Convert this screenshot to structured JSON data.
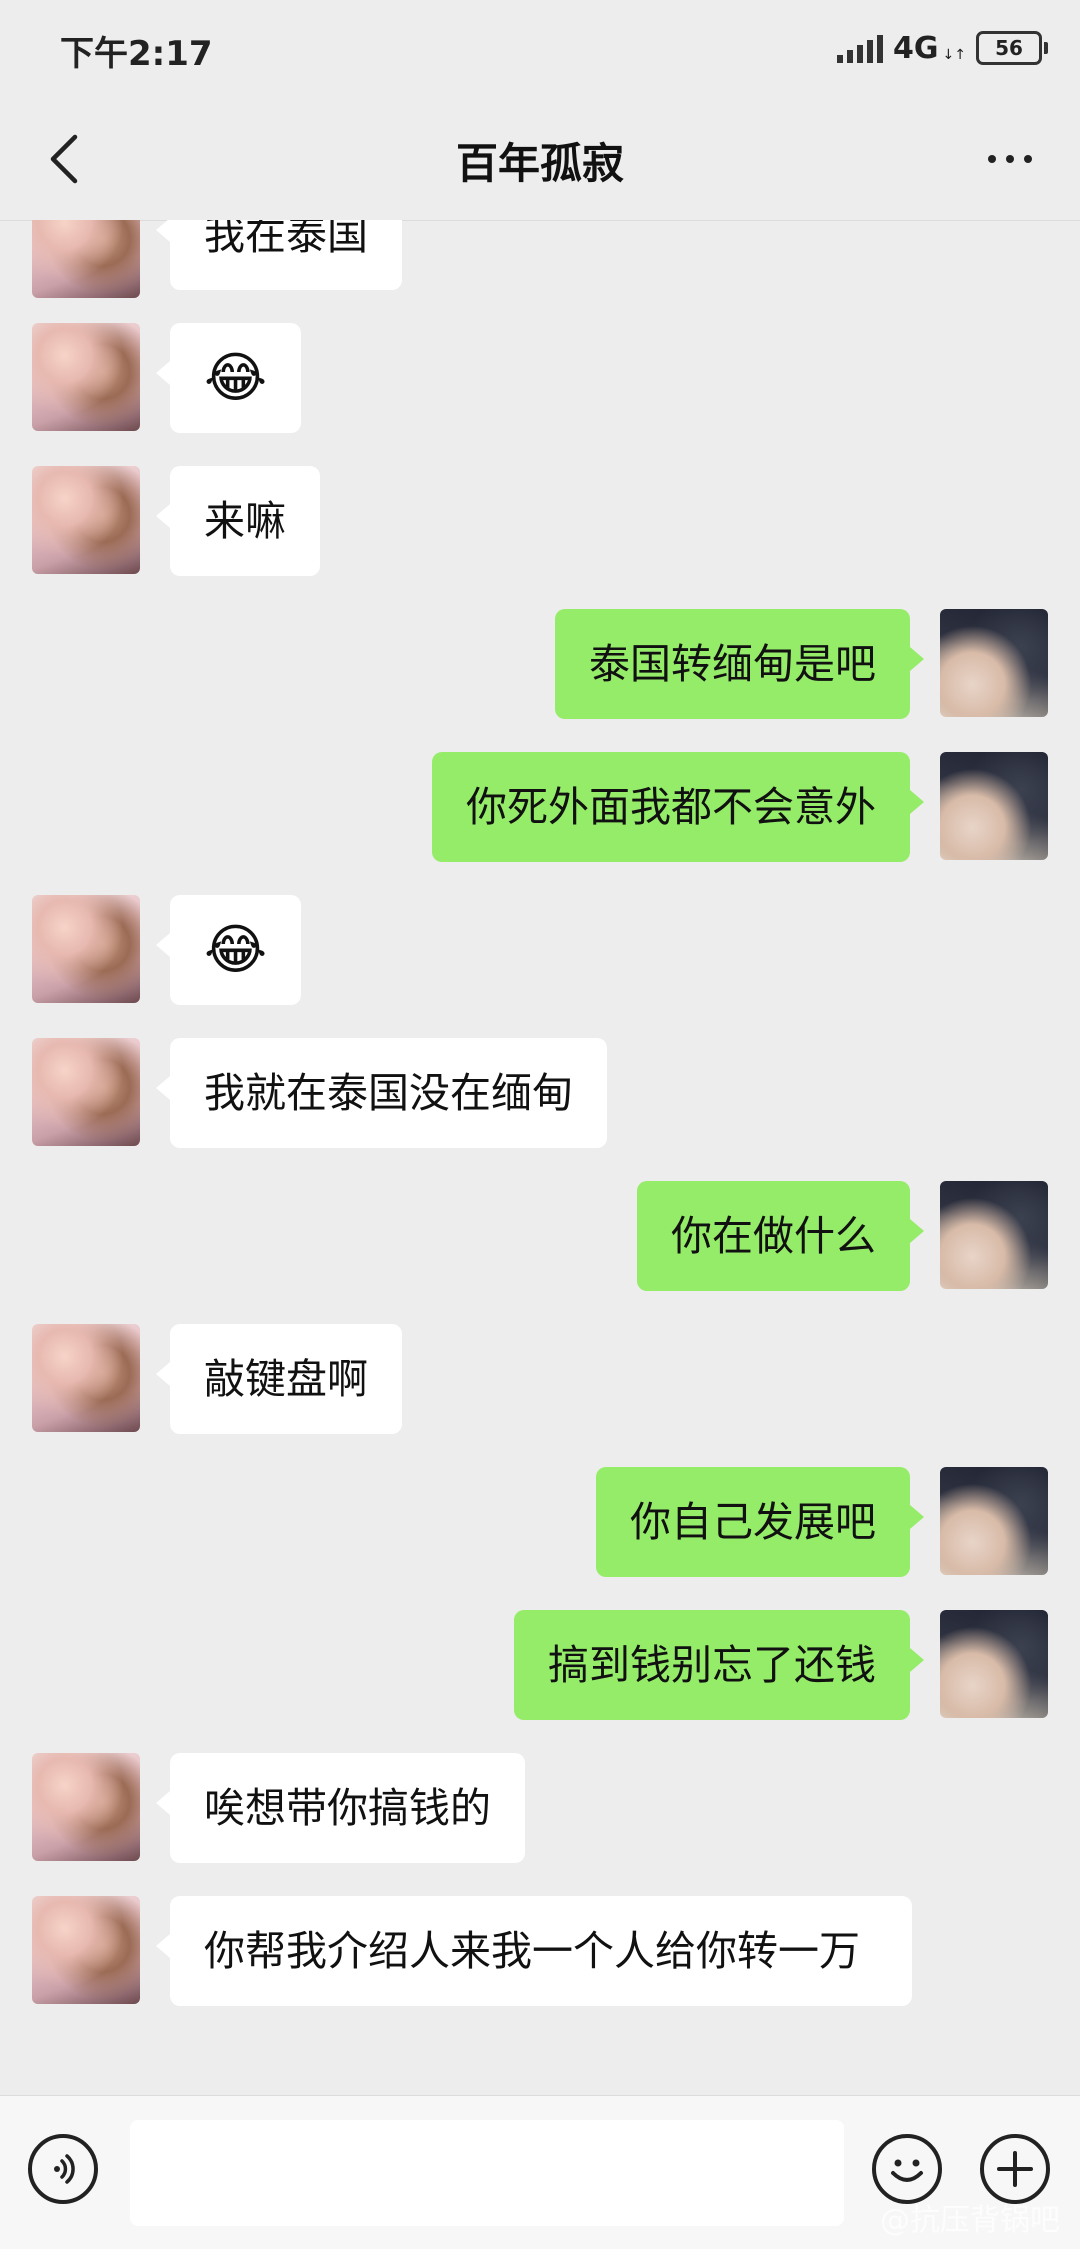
{
  "status_bar": {
    "time": "下午2:17",
    "network": "4G",
    "battery": "56"
  },
  "header": {
    "title": "百年孤寂",
    "back_icon": "chevron-left-icon",
    "more_icon": "more-dots-icon"
  },
  "messages": [
    {
      "side": "left",
      "type": "text",
      "text": "我在泰国"
    },
    {
      "side": "left",
      "type": "emoji",
      "text": "😂"
    },
    {
      "side": "left",
      "type": "text",
      "text": "来嘛"
    },
    {
      "side": "right",
      "type": "text",
      "text": "泰国转缅甸是吧"
    },
    {
      "side": "right",
      "type": "text",
      "text": "你死外面我都不会意外"
    },
    {
      "side": "left",
      "type": "emoji",
      "text": "😂"
    },
    {
      "side": "left",
      "type": "text",
      "text": "我就在泰国没在缅甸"
    },
    {
      "side": "right",
      "type": "text",
      "text": "你在做什么"
    },
    {
      "side": "left",
      "type": "text",
      "text": "敲键盘啊"
    },
    {
      "side": "right",
      "type": "text",
      "text": "你自己发展吧"
    },
    {
      "side": "right",
      "type": "text",
      "text": "搞到钱别忘了还钱"
    },
    {
      "side": "left",
      "type": "text",
      "text": "唉想带你搞钱的"
    },
    {
      "side": "left",
      "type": "text",
      "text": "你帮我介绍人来我一个人给你转一万"
    }
  ],
  "input_bar": {
    "voice_icon": "voice-icon",
    "emoji_icon": "emoji-face-icon",
    "plus_icon": "plus-icon",
    "value": ""
  },
  "watermark": "@抗压背锅吧",
  "colors": {
    "background": "#ededed",
    "sent_bubble": "#95ec69",
    "received_bubble": "#ffffff"
  }
}
